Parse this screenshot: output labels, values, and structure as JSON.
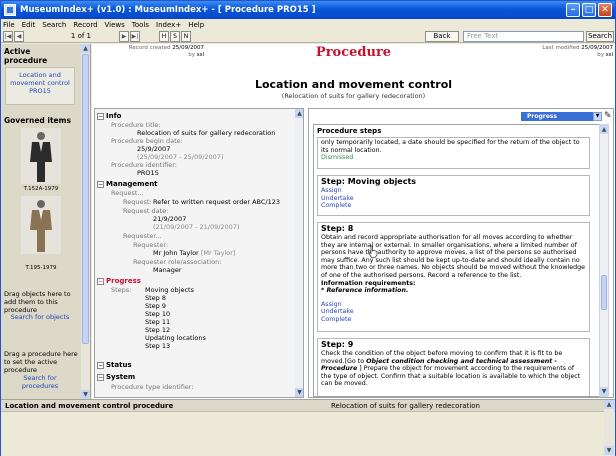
{
  "window": {
    "title": "MuseumIndex+ (v1.0) : MuseumIndex+ - [ Procedure PRO15 ]"
  },
  "menu": [
    "File",
    "Edit",
    "Search",
    "Record",
    "Views",
    "Tools",
    "Index+",
    "Help"
  ],
  "toolbar": {
    "record_counter": "1 of 1",
    "nav_letters": [
      "H",
      "S",
      "N"
    ],
    "back_label": "Back",
    "search_placeholder": "Free Text",
    "search_label": "Search"
  },
  "sidebar": {
    "active_header": "Active procedure",
    "active_link": "Location and movement control PRO15",
    "governed_header": "Governed items",
    "item1_caption": "T.152A-1979",
    "item2_caption": "T.195-1979",
    "drag_objects": "Drag objects here to add them to this procedure",
    "search_objects": "Search for objects",
    "drag_procedure": "Drag a procedure here to set the active procedure",
    "search_procedures": "Search for procedures"
  },
  "record": {
    "created_label": "Record created",
    "created_date": "25/09/2007",
    "created_by_label": "by",
    "created_by": "ssl",
    "modified_label": "Last modified",
    "modified_date": "25/09/2007",
    "modified_by_label": "by",
    "modified_by": "ssl",
    "type_title": "Procedure",
    "name": "Location and movement control",
    "subtitle": "(Relocation of suits for gallery redecoration)"
  },
  "left": {
    "info": "Info",
    "proc_title_label": "Procedure title:",
    "proc_title": "Relocation of suits for gallery redecoration",
    "begin_label": "Procedure begin date:",
    "begin_date": "25/9/2007",
    "begin_range": "(25/09/2007 - 25/09/2007)",
    "identifier_label": "Procedure identifier:",
    "identifier": "PRO15",
    "management": "Management",
    "request_label": "Request...",
    "request_sub_label": "Request:",
    "request": "Refer to written request order ABC/123",
    "request_date_label": "Request date:",
    "request_date": "21/9/2007",
    "request_range": "(21/09/2007 - 21/09/2007)",
    "requester_label": "Requester...",
    "requester_sub_label": "Requester:",
    "requester": "Mr John Taylor",
    "requester_tag": "[Mr Taylor]",
    "role_label": "Requester role/association:",
    "role": "Manager",
    "progress": "Progress",
    "steps_label": "Steps:",
    "steps": [
      "Moving objects",
      "Step 8",
      "Step 9",
      "Step 10",
      "Step 11",
      "Step 12",
      "Updating locations",
      "Step 13"
    ],
    "status": "Status",
    "system": "System",
    "proc_type_label": "Procedure type identifier:"
  },
  "right": {
    "progress_select": "Progress",
    "steps_header": "Procedure steps",
    "step0_text": "only temporarily located, a date should be specified for the return of the object to its normal location.",
    "step0_dismissed": "Dismissed",
    "step1_title": "Step: Moving objects",
    "assign": "Assign",
    "undertake": "Undertake",
    "complete": "Complete",
    "step8_title": "Step: 8",
    "step8_text": "Obtain and record appropriate authorisation for all moves according to whether they are internal or external. In smaller organisations, where a limited number of persons have the authority to approve moves, a list of the persons so authorised may suffice. Any such list should be kept up-to-date and should ideally contain no more than two or three names. No objects should be moved without the knowledge of one of the authorised persons. Record a reference to the list.",
    "info_req": "Information requirements:",
    "info_req_item": "* Reference information.",
    "step9_title": "Step: 9",
    "step9_text1": "Check the condition of the object before moving to confirm that it is fit to be moved.[Go to",
    "step9_link": "Object condition checking and technical assessment - Procedure",
    "step9_text2": "] Prepare the object for movement according to the requirements of the type of object. Confirm that a suitable location is available to which the object can be moved."
  },
  "bottom": {
    "title": "Location and movement control procedure",
    "subtitle": "Relocation of suits for gallery redecoration"
  }
}
